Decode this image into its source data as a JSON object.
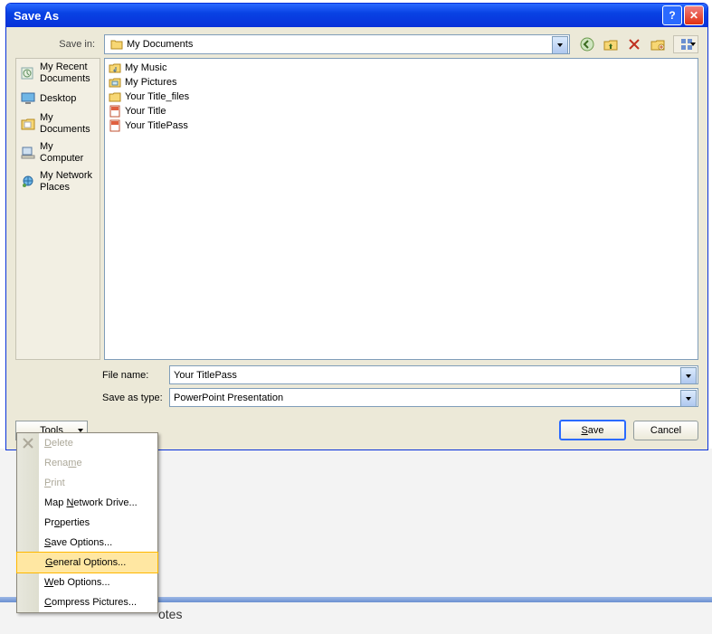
{
  "dialog": {
    "title": "Save As",
    "save_in_label": "Save in:",
    "save_in_value": "My Documents",
    "filename_label": "File name:",
    "filename_value": "Your TitlePass",
    "savetype_label": "Save as type:",
    "savetype_value": "PowerPoint Presentation",
    "tools_label": "Tools",
    "save_label": "Save",
    "cancel_label": "Cancel"
  },
  "sidebar": {
    "items": [
      {
        "label": "My Recent Documents"
      },
      {
        "label": "Desktop"
      },
      {
        "label": "My Documents"
      },
      {
        "label": "My Computer"
      },
      {
        "label": "My Network Places"
      }
    ]
  },
  "files": [
    {
      "name": "My Music",
      "type": "folder-music"
    },
    {
      "name": "My Pictures",
      "type": "folder-pics"
    },
    {
      "name": "Your Title_files",
      "type": "folder"
    },
    {
      "name": "Your Title",
      "type": "ppt"
    },
    {
      "name": "Your TitlePass",
      "type": "ppt"
    }
  ],
  "tools_menu": {
    "items": [
      {
        "label": "Delete",
        "u": 0,
        "disabled": true,
        "icon": "x"
      },
      {
        "label": "Rename",
        "u": 4,
        "disabled": true
      },
      {
        "label": "Print",
        "u": 0,
        "disabled": true
      },
      {
        "label": "Map Network Drive...",
        "u": 4
      },
      {
        "label": "Properties",
        "u": 2
      },
      {
        "label": "Save Options...",
        "u": 0
      },
      {
        "label": "General Options...",
        "u": 0,
        "hl": true
      },
      {
        "label": "Web Options...",
        "u": 0
      },
      {
        "label": "Compress Pictures...",
        "u": 0
      }
    ]
  },
  "notes_text": "otes"
}
